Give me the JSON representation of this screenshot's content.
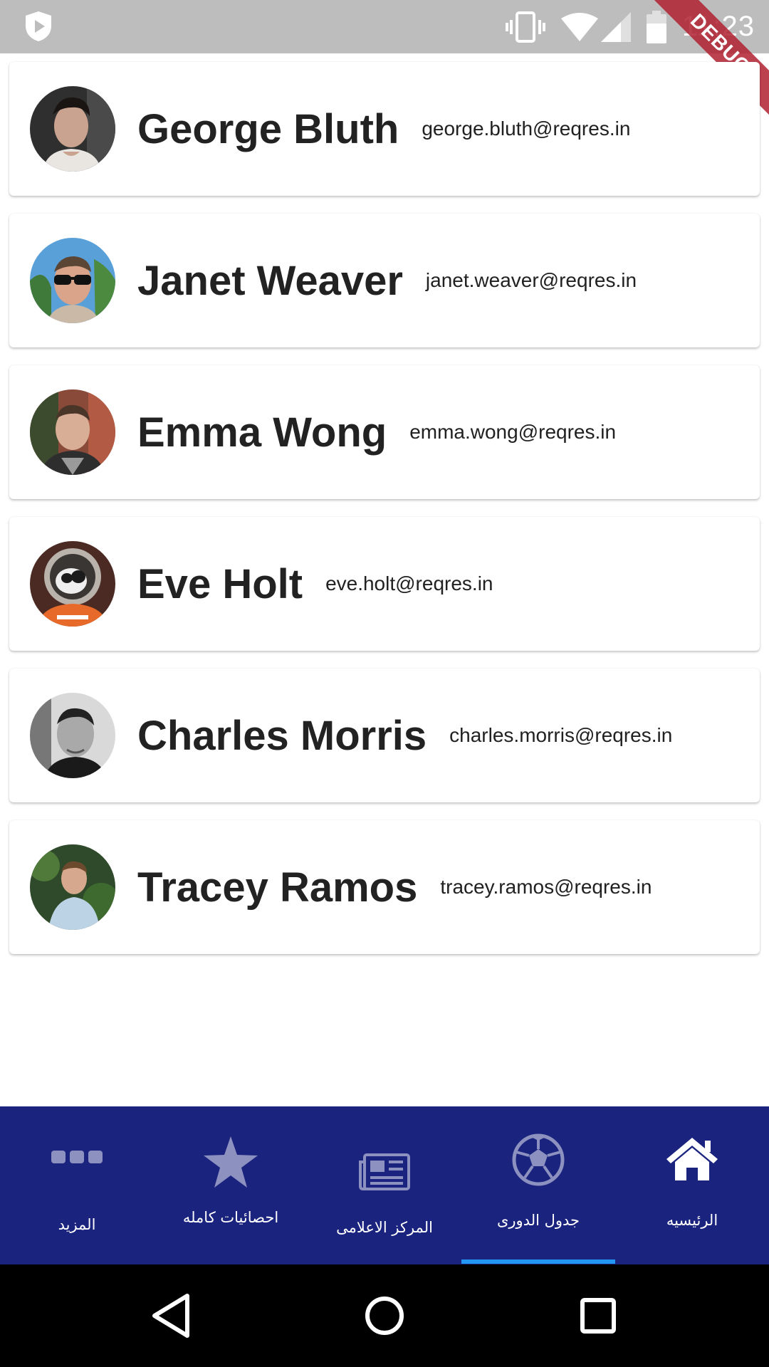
{
  "status_bar": {
    "time": "11:23",
    "icons": [
      "shield-play-icon",
      "vibrate-icon",
      "wifi-icon",
      "signal-icon",
      "battery-icon"
    ]
  },
  "debug_banner": {
    "label": "DEBUG"
  },
  "users": [
    {
      "name": "George Bluth",
      "email": "george.bluth@reqres.in"
    },
    {
      "name": "Janet Weaver",
      "email": "janet.weaver@reqres.in"
    },
    {
      "name": "Emma Wong",
      "email": "emma.wong@reqres.in"
    },
    {
      "name": "Eve Holt",
      "email": "eve.holt@reqres.in"
    },
    {
      "name": "Charles Morris",
      "email": "charles.morris@reqres.in"
    },
    {
      "name": "Tracey Ramos",
      "email": "tracey.ramos@reqres.in"
    }
  ],
  "bottom_nav": {
    "items": [
      {
        "label": "المزيد",
        "icon": "more-dots-icon"
      },
      {
        "label": "احصائيات كامله",
        "icon": "star-icon"
      },
      {
        "label": "المركز الاعلامى",
        "icon": "newspaper-icon"
      },
      {
        "label": "جدول الدورى",
        "icon": "soccer-ball-icon"
      },
      {
        "label": "الرئيسيه",
        "icon": "home-icon"
      }
    ],
    "selected_index": 3,
    "colors": {
      "background": "#1a237e",
      "indicator": "#2196f3",
      "inactive_icon": "#8c91c0",
      "active_icon": "#ffffff"
    }
  },
  "system_nav": {
    "icons": [
      "back-icon",
      "home-circle-icon",
      "recents-icon"
    ]
  }
}
